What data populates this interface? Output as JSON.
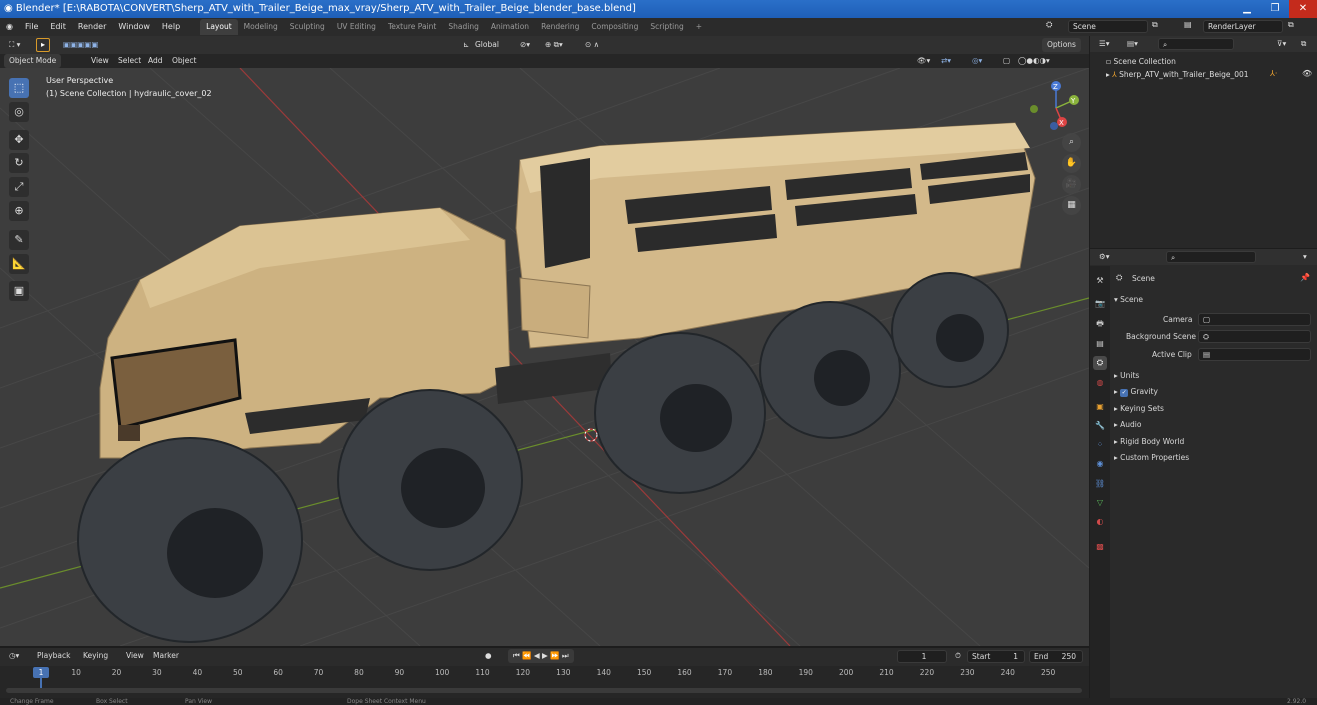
{
  "title": "Blender* [E:\\RABOTA\\CONVERT\\Sherp_ATV_with_Trailer_Beige_max_vray/Sherp_ATV_with_Trailer_Beige_blender_base.blend]",
  "menu": [
    "File",
    "Edit",
    "Render",
    "Window",
    "Help"
  ],
  "workspaces": [
    "Layout",
    "Modeling",
    "Sculpting",
    "UV Editing",
    "Texture Paint",
    "Shading",
    "Animation",
    "Rendering",
    "Compositing",
    "Scripting"
  ],
  "scene_field": "Scene",
  "renderlayer_field": "RenderLayer",
  "viewport": {
    "mode": "Object Mode",
    "menus": [
      "View",
      "Select",
      "Add",
      "Object"
    ],
    "transform": "Global",
    "options": "Options",
    "overlay_title": "User Perspective",
    "overlay_sub": "(1) Scene Collection | hydraulic_cover_02",
    "gizmo": {
      "x": "X",
      "y": "Y",
      "z": "Z"
    }
  },
  "outliner": {
    "root": "Scene Collection",
    "item": "Sherp_ATV_with_Trailer_Beige_001"
  },
  "properties": {
    "header": "Scene",
    "section": "Scene",
    "camera_label": "Camera",
    "bg_label": "Background Scene",
    "clip_label": "Active Clip",
    "panels": [
      "Units",
      "Gravity",
      "Keying Sets",
      "Audio",
      "Rigid Body World",
      "Custom Properties"
    ]
  },
  "timeline": {
    "menus": [
      "Playback",
      "Keying",
      "View",
      "Marker"
    ],
    "current_frame": "1",
    "start_label": "Start",
    "start": "1",
    "end_label": "End",
    "end": "250",
    "ticks": [
      "1",
      "10",
      "20",
      "30",
      "40",
      "50",
      "60",
      "70",
      "80",
      "90",
      "100",
      "110",
      "120",
      "130",
      "140",
      "150",
      "160",
      "170",
      "180",
      "190",
      "200",
      "210",
      "220",
      "230",
      "240",
      "250"
    ]
  },
  "status": {
    "items": [
      "Change Frame",
      "Box Select",
      "Pan View",
      "Dope Sheet Context Menu"
    ],
    "version": "2.92.0"
  },
  "colors": {
    "accent": "#4772b3",
    "active_tab": "#3e3e3e",
    "titlebar": "#1e5fb8"
  }
}
